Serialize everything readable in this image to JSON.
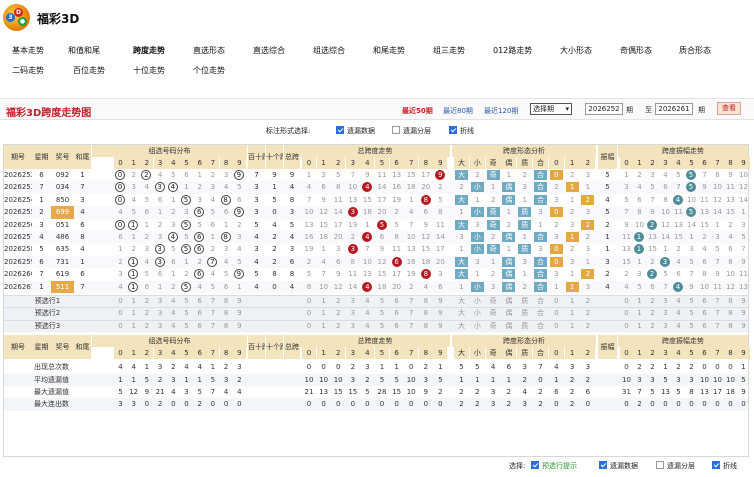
{
  "app": {
    "title": "福彩3D"
  },
  "nav": [
    "基本走势",
    "和值和尾",
    "跨度走势",
    "直选形态",
    "直选综合",
    "组选综合",
    "和尾走势",
    "组三走势",
    "012路走势",
    "大小形态",
    "奇偶形态",
    "质合形态",
    "二码走势",
    "百位走势",
    "十位走势",
    "个位走势"
  ],
  "nav_active": 2,
  "controls": {
    "title": "福彩3D跨度走势图",
    "periods": [
      "最近50期",
      "最近80期",
      "最近120期"
    ],
    "period_active": 0,
    "select_value": "选择期",
    "from": "2026252",
    "to": "2026261",
    "qi": "期",
    "zhi": "至",
    "query": "查看"
  },
  "options": {
    "label": "标注形式选择:",
    "items": [
      {
        "label": "遗漏数据",
        "checked": true
      },
      {
        "label": "遗漏分层",
        "checked": false
      },
      {
        "label": "折线",
        "checked": true
      }
    ]
  },
  "headers": {
    "issue": "期号",
    "week": "星期",
    "prize": "奖号",
    "sum": "和尾",
    "group_dist": "组选号码分布",
    "hundred_ten": "百十跨",
    "ten_unit": "十个跨",
    "total_span": "总跨",
    "total_span_trend": "总跨度走势",
    "span_form": "跨度形态分析",
    "amp": "振幅",
    "span_amp_trend": "跨度振幅走势",
    "form_labels": [
      "大",
      "小",
      "奇",
      "偶",
      "质",
      "合",
      "0",
      "1",
      "2"
    ]
  },
  "digits": [
    "0",
    "1",
    "2",
    "3",
    "4",
    "5",
    "6",
    "7",
    "8",
    "9"
  ],
  "digits_1_9": [
    "1",
    "2",
    "3",
    "4",
    "5",
    "6",
    "7",
    "8",
    "9"
  ],
  "rows": [
    {
      "issue": "2026252",
      "week": "6",
      "prize": "092",
      "sum": "1",
      "ht": "7",
      "tu": "9",
      "span": "9",
      "amp": "5"
    },
    {
      "issue": "2026253",
      "week": "7",
      "prize": "034",
      "sum": "7",
      "ht": "3",
      "tu": "1",
      "span": "4",
      "amp": "5"
    },
    {
      "issue": "2026254",
      "week": "1",
      "prize": "850",
      "sum": "3",
      "ht": "3",
      "tu": "5",
      "span": "8",
      "amp": "4"
    },
    {
      "issue": "2026255",
      "week": "2",
      "prize": "699",
      "sum": "4",
      "ht": "3",
      "tu": "0",
      "span": "3",
      "amp": "5"
    },
    {
      "issue": "2026256",
      "week": "3",
      "prize": "051",
      "sum": "6",
      "ht": "5",
      "tu": "4",
      "span": "5",
      "amp": "2"
    },
    {
      "issue": "2026257",
      "week": "4",
      "prize": "486",
      "sum": "8",
      "ht": "4",
      "tu": "2",
      "span": "4",
      "amp": "1"
    },
    {
      "issue": "2026258",
      "week": "5",
      "prize": "635",
      "sum": "4",
      "ht": "3",
      "tu": "2",
      "span": "3",
      "amp": "1"
    },
    {
      "issue": "2026259",
      "week": "6",
      "prize": "731",
      "sum": "1",
      "ht": "4",
      "tu": "2",
      "span": "6",
      "amp": "3"
    },
    {
      "issue": "2026260",
      "week": "7",
      "prize": "619",
      "sum": "6",
      "ht": "5",
      "tu": "8",
      "span": "8",
      "amp": "2"
    },
    {
      "issue": "2026261",
      "week": "1",
      "prize": "511",
      "sum": "7",
      "ht": "4",
      "tu": "0",
      "span": "4",
      "amp": "4"
    }
  ],
  "preselect": [
    "预选行1",
    "预选行2",
    "预选行3"
  ],
  "stats": [
    {
      "label": "出现总次数",
      "group": [
        "4",
        "4",
        "1",
        "3",
        "2",
        "4",
        "4",
        "1",
        "2",
        "3"
      ],
      "hs": "",
      "span": [
        "0",
        "0",
        "0",
        "2",
        "3",
        "1",
        "1",
        "0",
        "2",
        "1"
      ],
      "form": [
        "5",
        "5",
        "4",
        "6",
        "3",
        "7",
        "4",
        "3",
        "3"
      ],
      "amp": [
        "0",
        "2",
        "2",
        "1",
        "2",
        "2",
        "0",
        "0",
        "0",
        "1"
      ]
    },
    {
      "label": "平均遗漏值",
      "group": [
        "1",
        "1",
        "5",
        "2",
        "3",
        "1",
        "1",
        "5",
        "3",
        "2"
      ],
      "hs": "",
      "span": [
        "10",
        "10",
        "10",
        "3",
        "2",
        "5",
        "5",
        "10",
        "3",
        "5"
      ],
      "form": [
        "1",
        "1",
        "1",
        "1",
        "2",
        "0",
        "1",
        "2",
        "2"
      ],
      "amp": [
        "10",
        "3",
        "3",
        "5",
        "3",
        "3",
        "10",
        "10",
        "10",
        "5"
      ]
    },
    {
      "label": "最大遗漏值",
      "group": [
        "5",
        "12",
        "9",
        "21",
        "4",
        "3",
        "5",
        "7",
        "4",
        "4"
      ],
      "hs": "",
      "span": [
        "21",
        "13",
        "15",
        "15",
        "5",
        "28",
        "15",
        "10",
        "9",
        "2"
      ],
      "form": [
        "2",
        "2",
        "3",
        "2",
        "4",
        "2",
        "6",
        "2",
        "6"
      ],
      "amp": [
        "31",
        "7",
        "5",
        "13",
        "5",
        "8",
        "13",
        "17",
        "18",
        "9"
      ]
    },
    {
      "label": "最大连出数",
      "group": [
        "3",
        "3",
        "0",
        "2",
        "0",
        "0",
        "2",
        "0",
        "0",
        "0"
      ],
      "hs": "",
      "span": [
        "0",
        "0",
        "0",
        "0",
        "0",
        "0",
        "0",
        "0",
        "0",
        "0"
      ],
      "form": [
        "2",
        "2",
        "3",
        "2",
        "3",
        "2",
        "0",
        "2",
        "0"
      ],
      "amp": [
        "0",
        "2",
        "0",
        "0",
        "0",
        "0",
        "0",
        "0",
        "0",
        "0"
      ]
    }
  ],
  "bottom": {
    "label": "选择:",
    "items": [
      {
        "label": "预选行提示",
        "checked": true
      },
      {
        "label": "遗漏数据",
        "checked": true
      },
      {
        "label": "遗漏分层",
        "checked": false
      },
      {
        "label": "折线",
        "checked": true
      }
    ]
  }
}
